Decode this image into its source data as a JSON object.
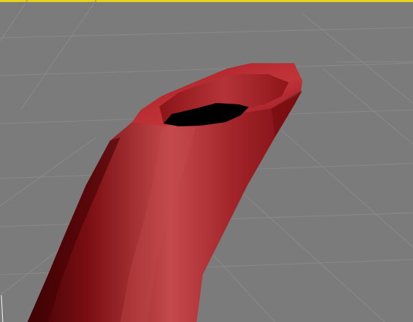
{
  "viewport": {
    "active_border_color": "#e8d21c",
    "background_color": "#7b7b7b",
    "grid_color": "#8a8a8a",
    "grid_visible": true
  },
  "object": {
    "type": "bent tube mesh",
    "base_color": "#9b1a1f",
    "highlight_color": "#c44a4c",
    "shadow_color": "#3f0204",
    "opening_color": "#000000"
  }
}
